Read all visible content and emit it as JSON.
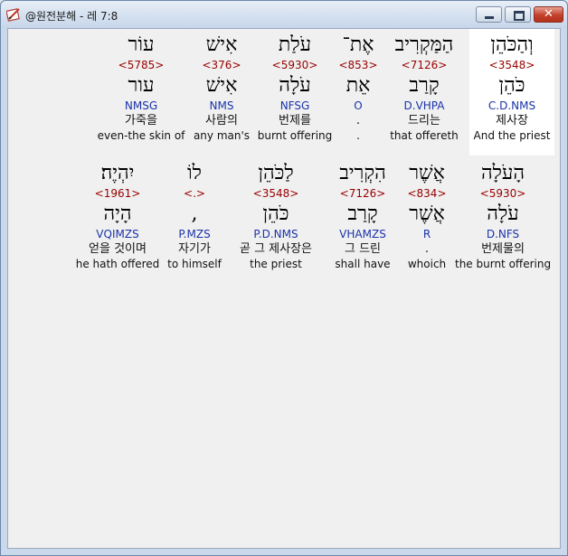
{
  "window": {
    "title": "@원전분해 - 레 7:8",
    "app_icon": "pencil-book-icon",
    "close_label": "✕"
  },
  "rows": [
    {
      "words": [
        {
          "hebrew": "עוֹר",
          "strong": "<5785>",
          "root": "עור",
          "morph": "NMSG",
          "korean": "가죽을",
          "english": "even-the skin of"
        },
        {
          "hebrew": "אִישׁ",
          "strong": "<376>",
          "root": "אִישׁ",
          "morph": "NMS",
          "korean": "사람의",
          "english": "any man's"
        },
        {
          "hebrew": "עֹלַת",
          "strong": "<5930>",
          "root": "עֹלָה",
          "morph": "NFSG",
          "korean": "번제를",
          "english": "burnt offering"
        },
        {
          "hebrew": "אֶת־",
          "strong": "<853>",
          "root": "אֵת",
          "morph": "O",
          "korean": ".",
          "english": "."
        },
        {
          "hebrew": "הַמַּקְרִיב",
          "strong": "<7126>",
          "root": "קָרַב",
          "morph": "D.VHPA",
          "korean": "드리는",
          "english": "that offereth"
        },
        {
          "hebrew": "וְהַכֹּהֵן",
          "strong": "<3548>",
          "root": "כֹּהֵן",
          "morph": "C.D.NMS",
          "korean": "제사장",
          "english": "And the priest"
        }
      ]
    },
    {
      "words": [
        {
          "hebrew": "יִהְיֶה׃",
          "strong": "<1961>",
          "root": "הָיָה",
          "morph": "VQIMZS",
          "korean": "얻을 것이며",
          "english": "he hath offered"
        },
        {
          "hebrew": "לוֹ",
          "strong": "<.>",
          "root": ",",
          "morph": "P.MZS",
          "korean": "자기가",
          "english": "to himself"
        },
        {
          "hebrew": "לַכֹּהֵן",
          "strong": "<3548>",
          "root": "כֹּהֵן",
          "morph": "P.D.NMS",
          "korean": "곧 그 제사장은",
          "english": "the priest"
        },
        {
          "hebrew": "הִקְרִיב",
          "strong": "<7126>",
          "root": "קָרַב",
          "morph": "VHAMZS",
          "korean": "그 드린",
          "english": "shall have"
        },
        {
          "hebrew": "אֲשֶׁר",
          "strong": "<834>",
          "root": "אֲשֶׁר",
          "morph": "R",
          "korean": ".",
          "english": "whoich"
        },
        {
          "hebrew": "הָעֹלָה",
          "strong": "<5930>",
          "root": "עֹלָה",
          "morph": "D.NFS",
          "korean": "번제물의",
          "english": "the burnt offering"
        }
      ]
    }
  ]
}
